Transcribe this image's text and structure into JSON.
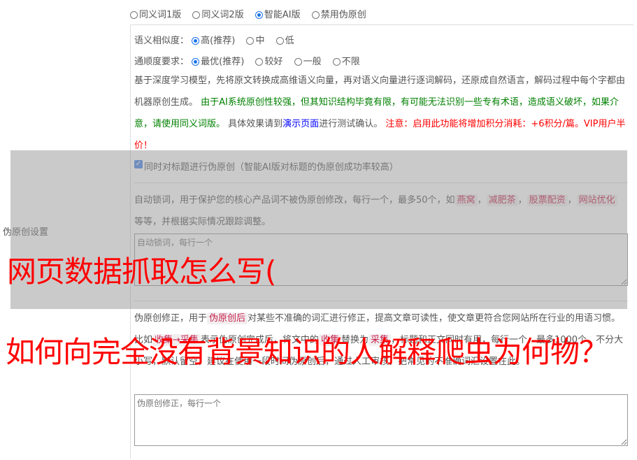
{
  "versions": {
    "options": [
      "同义词1版",
      "同义词2版",
      "智能AI版",
      "禁用伪原创"
    ],
    "selected": 2
  },
  "similarity": {
    "label": "语义相似度：",
    "options": [
      "高(推荐)",
      "中",
      "低"
    ],
    "selected": 0
  },
  "fluency": {
    "label": "通顺度要求：",
    "options": [
      "最优(推荐)",
      "较好",
      "一般",
      "不限"
    ],
    "selected": 0
  },
  "description": {
    "intro": "基于深度学习模型，先将原文转换成高维语义向量，再对语义向量进行逐词解码，还原成自然语言，解码过程中每个字都由机器原创生成。",
    "warning_green": "由于AI系统原创性较强，但其知识结构毕竟有限，有可能无法识别一些专有术语，造成语义破坏，如果介意，请使用同义词版。",
    "test_prefix": "具体效果请到",
    "demo_link": "演示页面",
    "test_suffix": "进行测试确认。",
    "notice_red": "注意：启用此功能将增加积分消耗：+6积分/篇。VIP用户半价！"
  },
  "section_label": "伪原创设置",
  "title_checkbox": {
    "label": "同时对标题进行伪原创（智能AI版对标题的伪原创成功率较高）",
    "checked": true
  },
  "lock_words": {
    "text_before": "自动锁词，用于保护您的核心产品词不被伪原创修改，每行一个，最多50个，如",
    "tags": [
      "燕窝",
      "减肥茶",
      "股票配资",
      "网站优化"
    ],
    "text_after": "等等，并根据实际情况跟踪调整。",
    "placeholder": "自动锁词，每行一个"
  },
  "correction": {
    "text_before": "伪原创修正，用于",
    "tag": "伪原创后",
    "text_after": "对某些不准确的词汇进行修正，提高文章可读性，使文章更符合您网站所在行业的用语习惯。比如",
    "example_tag": "收集→采集",
    "text_mid": "表示伪原创完成后，将文中的",
    "tag2": "收集",
    "text_mid2": "替换为",
    "tag3": "采集",
    "text_end": "，标题和正文同时有用，每行一个，最多1000个，不分大小写，默认留空。建议在使用一段时间伪原创后，通过人工审核，把常见的不准确词汇设置在此。",
    "placeholder": "伪原创修正，每行一个"
  },
  "overlay_title_1": "网页数据抓取怎么写(",
  "overlay_title_2": "如何向完全没有背景知识的人解释爬虫为何物？",
  "colors": {
    "accent": "#1a73e8",
    "green": "#008000",
    "red": "#ff0000",
    "link": "#0000ff",
    "tag": "#c7254e"
  }
}
